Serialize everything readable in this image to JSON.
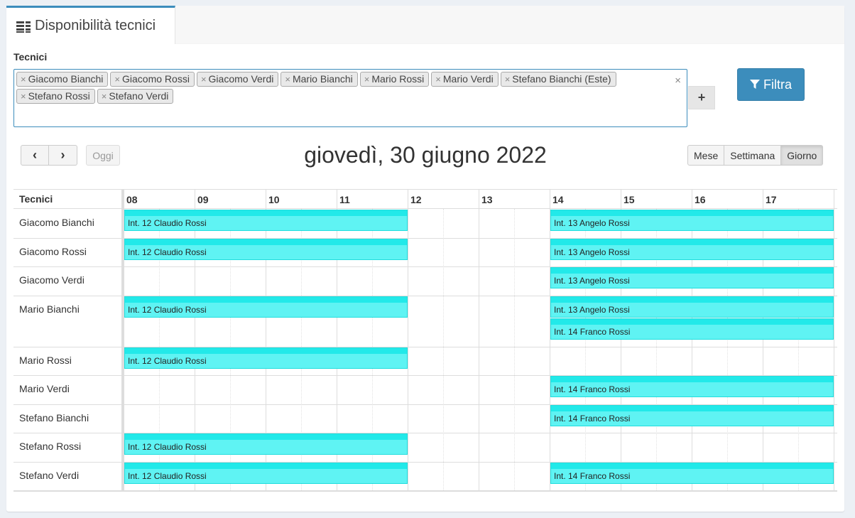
{
  "tab": {
    "title": "Disponibilità tecnici",
    "icon": "list-icon"
  },
  "filter": {
    "label": "Tecnici",
    "tags": [
      "Giacomo Bianchi",
      "Giacomo Rossi",
      "Giacomo Verdi",
      "Mario Bianchi",
      "Mario Rossi",
      "Mario Verdi",
      "Stefano Bianchi (Este)",
      "Stefano Rossi",
      "Stefano Verdi"
    ],
    "remove_glyph": "×",
    "clear_glyph": "×",
    "add_glyph": "+",
    "filter_button": "Filtra"
  },
  "calendar": {
    "prev_glyph": "‹",
    "next_glyph": "›",
    "today": "Oggi",
    "title": "giovedì, 30 giugno 2022",
    "views": [
      "Mese",
      "Settimana",
      "Giorno"
    ],
    "active_view": "Giorno",
    "resource_header": "Tecnici",
    "hours": [
      "08",
      "09",
      "10",
      "11",
      "12",
      "13",
      "14",
      "15",
      "16",
      "17"
    ],
    "resources": [
      "Giacomo Bianchi",
      "Giacomo Rossi",
      "Giacomo Verdi",
      "Mario Bianchi",
      "Mario Rossi",
      "Mario Verdi",
      "Stefano Bianchi",
      "Stefano Rossi",
      "Stefano Verdi"
    ],
    "events": [
      {
        "resource": 0,
        "label": "Int. 12 Claudio Rossi",
        "start": "08:00",
        "end": "12:00"
      },
      {
        "resource": 0,
        "label": "Int. 13 Angelo Rossi",
        "start": "14:00",
        "end": "18:00"
      },
      {
        "resource": 1,
        "label": "Int. 12 Claudio Rossi",
        "start": "08:00",
        "end": "12:00"
      },
      {
        "resource": 1,
        "label": "Int. 13 Angelo Rossi",
        "start": "14:00",
        "end": "18:00"
      },
      {
        "resource": 2,
        "label": "Int. 13 Angelo Rossi",
        "start": "14:00",
        "end": "18:00"
      },
      {
        "resource": 3,
        "label": "Int. 12 Claudio Rossi",
        "start": "08:00",
        "end": "12:00"
      },
      {
        "resource": 3,
        "label": "Int. 13 Angelo Rossi",
        "start": "14:00",
        "end": "18:00"
      },
      {
        "resource": 3,
        "label": "Int. 14 Franco Rossi",
        "start": "14:00",
        "end": "18:00"
      },
      {
        "resource": 4,
        "label": "Int. 12 Claudio Rossi",
        "start": "08:00",
        "end": "12:00"
      },
      {
        "resource": 5,
        "label": "Int. 14 Franco Rossi",
        "start": "14:00",
        "end": "18:00"
      },
      {
        "resource": 6,
        "label": "Int. 14 Franco Rossi",
        "start": "14:00",
        "end": "18:00"
      },
      {
        "resource": 7,
        "label": "Int. 12 Claudio Rossi",
        "start": "08:00",
        "end": "12:00"
      },
      {
        "resource": 8,
        "label": "Int. 12 Claudio Rossi",
        "start": "08:00",
        "end": "12:00"
      },
      {
        "resource": 8,
        "label": "Int. 14 Franco Rossi",
        "start": "14:00",
        "end": "18:00"
      }
    ]
  },
  "colors": {
    "primary": "#3c8dbc",
    "event": "#5ff3f3",
    "event_top": "#22e9e9"
  }
}
